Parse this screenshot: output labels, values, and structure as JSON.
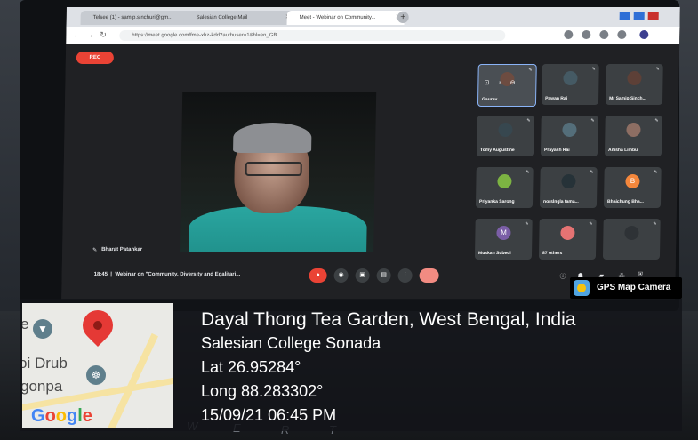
{
  "browser": {
    "tabs": [
      {
        "label": "Telsee (1) - samip.sinchuri@gm...",
        "active": false
      },
      {
        "label": "Salesian College Mail",
        "active": false
      },
      {
        "label": "Meet - Webinar on Community...",
        "active": true
      }
    ],
    "url": "https://meet.google.com/fme-xhz-kdd?authuser=1&hl=en_GB"
  },
  "meet": {
    "rec_label": "REC",
    "speaker_name": "Bharat Patankar",
    "time": "18:45",
    "meeting_title": "Webinar on \"Community, Diversity and Egalitari...",
    "participants": [
      {
        "name": "Gaurav",
        "avatar_color": "#6d4c41",
        "letter": ""
      },
      {
        "name": "Pawan Rai",
        "avatar_color": "#455a64",
        "letter": ""
      },
      {
        "name": "Mr Samip Sinch...",
        "avatar_color": "#5d4037",
        "letter": ""
      },
      {
        "name": "Tomy Augustine",
        "avatar_color": "#37474f",
        "letter": ""
      },
      {
        "name": "Prayash Rai",
        "avatar_color": "#546e7a",
        "letter": ""
      },
      {
        "name": "Anisha Limbu",
        "avatar_color": "#8d6e63",
        "letter": ""
      },
      {
        "name": "Priyanka Sarong",
        "avatar_color": "#7cb342",
        "letter": ""
      },
      {
        "name": "norslngla tama...",
        "avatar_color": "#263238",
        "letter": ""
      },
      {
        "name": "Bhaichung Bha...",
        "avatar_color": "#f4873c",
        "letter": "B"
      },
      {
        "name": "Muskan Subedi",
        "avatar_color": "#7b5ea7",
        "letter": "M"
      },
      {
        "name": "87 others",
        "avatar_color": "#e57373",
        "letter": ""
      },
      {
        "name": "",
        "avatar_color": "#2e3236",
        "letter": ""
      }
    ]
  },
  "gps": {
    "brand": "GPS Map Camera",
    "location_title": "Dayal Thong Tea Garden, West Bengal, India",
    "place": "Salesian College Sonada",
    "lat": "Lat 26.95284°",
    "long": "Long 88.283302°",
    "datetime": "15/09/21 06:45 PM",
    "map_labels": [
      "e",
      "oi Drub",
      "gonpa"
    ],
    "google_logo": "Google"
  },
  "colors": {
    "pin_red": "#e53935",
    "meet_bg": "#202124",
    "rec_red": "#ea4335"
  },
  "icons": [
    "map-pin-icon",
    "dharma-wheel-icon",
    "location-arrow-icon",
    "gps-camera-icon",
    "mic-icon",
    "camera-icon",
    "present-icon",
    "hangup-icon",
    "info-icon",
    "people-icon",
    "chat-icon"
  ]
}
